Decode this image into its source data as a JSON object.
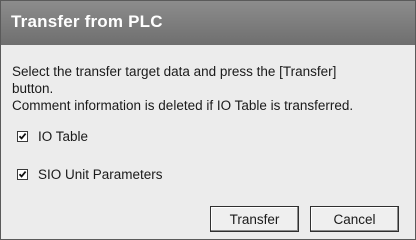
{
  "dialog": {
    "title": "Transfer from PLC",
    "message_line1": "Select the transfer target data and press the [Transfer]",
    "message_line2": "button.",
    "message_line3": "Comment information is deleted if IO Table is transferred."
  },
  "options": [
    {
      "label": "IO Table",
      "checked": true
    },
    {
      "label": "SIO Unit Parameters",
      "checked": true
    }
  ],
  "buttons": {
    "transfer_label": "Transfer",
    "cancel_label": "Cancel"
  },
  "icons": {
    "checkmark": "checkmark-icon"
  }
}
